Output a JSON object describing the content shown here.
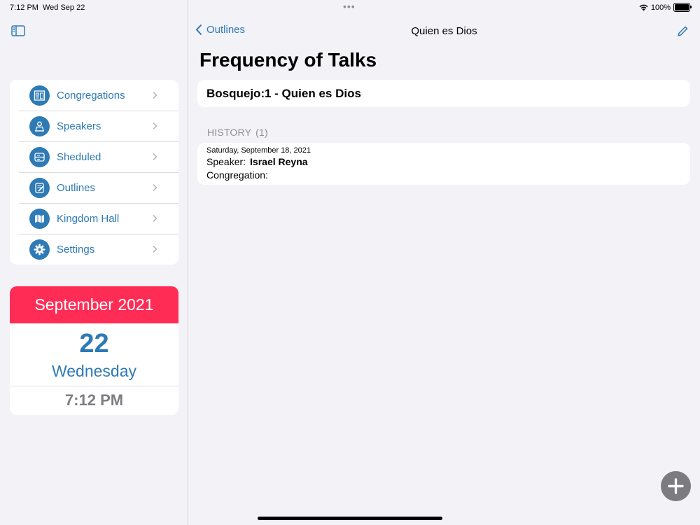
{
  "status_bar": {
    "time": "7:12 PM",
    "date": "Wed Sep 22",
    "multitask_dots": "•••",
    "battery_percent": "100%",
    "battery_level": 1.0,
    "wifi_icon": "wifi-icon",
    "battery_icon": "battery-icon"
  },
  "sidebar": {
    "toggle_icon": "sidebar-toggle-icon",
    "items": [
      {
        "label": "Congregations",
        "icon": "congregations-icon"
      },
      {
        "label": "Speakers",
        "icon": "speakers-icon"
      },
      {
        "label": "Sheduled",
        "icon": "scheduled-icon"
      },
      {
        "label": "Outlines",
        "icon": "outlines-icon"
      },
      {
        "label": "Kingdom Hall",
        "icon": "map-icon"
      },
      {
        "label": "Settings",
        "icon": "gear-icon"
      }
    ]
  },
  "calendar": {
    "month_year": "September 2021",
    "day": "22",
    "weekday": "Wednesday",
    "time": "7:12 PM"
  },
  "navbar": {
    "back_label": "Outlines",
    "title": "Quien es Dios",
    "edit_icon": "pencil-icon"
  },
  "page": {
    "title": "Frequency of Talks",
    "outline_label": "Bosquejo:",
    "outline_value": "1 - Quien es Dios"
  },
  "history": {
    "header": "HISTORY",
    "count": "(1)",
    "entries": [
      {
        "date": "Saturday, September 18, 2021",
        "speaker_label": "Speaker:",
        "speaker": "Israel Reyna",
        "congregation_label": "Congregation:",
        "congregation": ""
      }
    ]
  },
  "colors": {
    "accent": "#2e7ab5",
    "calendar_header": "#ff2d55",
    "background": "#f2f2f7",
    "fab": "#7b7b80"
  }
}
